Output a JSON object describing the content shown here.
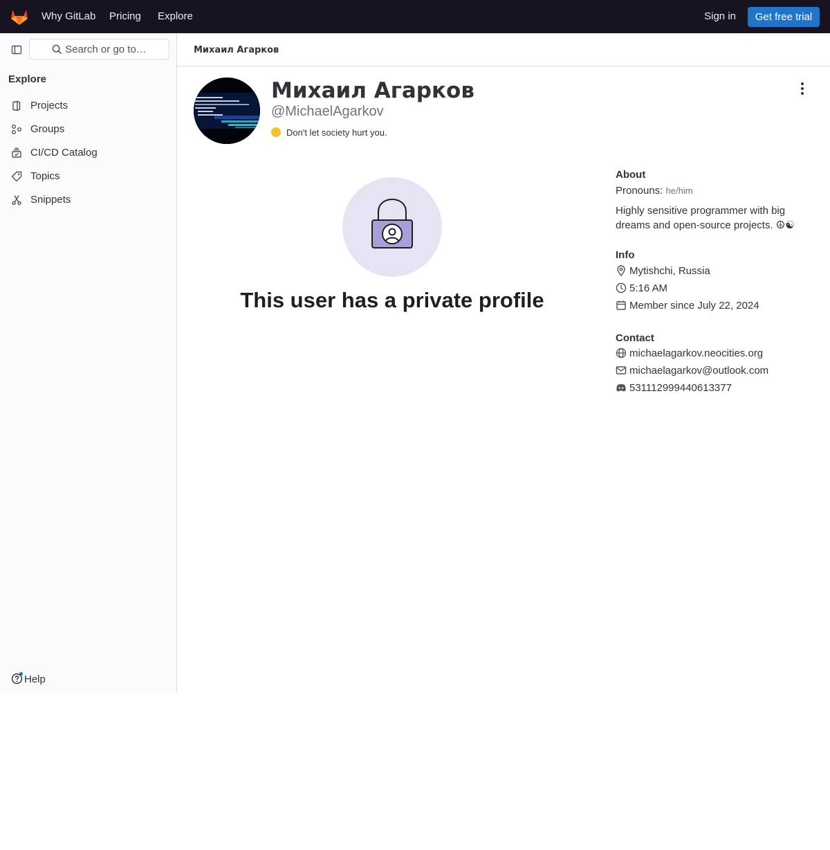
{
  "topbar": {
    "nav": [
      "Why GitLab",
      "Pricing",
      "Explore"
    ],
    "sign_in": "Sign in",
    "trial_button": "Get free trial"
  },
  "sidebar": {
    "search_placeholder": "Search or go to…",
    "section_title": "Explore",
    "items": [
      {
        "label": "Projects",
        "icon": "project-icon"
      },
      {
        "label": "Groups",
        "icon": "group-icon"
      },
      {
        "label": "CI/CD Catalog",
        "icon": "catalog-icon"
      },
      {
        "label": "Topics",
        "icon": "label-icon"
      },
      {
        "label": "Snippets",
        "icon": "snippet-icon"
      }
    ],
    "help_label": "Help"
  },
  "breadcrumb": "Михаил Агарков",
  "profile": {
    "name": "Михаил Агарков",
    "username": "@MichaelAgarkov",
    "status_text": "Don't let society hurt you.",
    "private_message": "This user has a private profile"
  },
  "about": {
    "heading": "About",
    "pronouns_label": "Pronouns:",
    "pronouns_value": "he/him",
    "bio": "Highly sensitive programmer with big dreams and open-source projects. ☮☯"
  },
  "info": {
    "heading": "Info",
    "location": "Mytishchi, Russia",
    "local_time": "5:16 AM",
    "member_since": "Member since July 22, 2024"
  },
  "contact": {
    "heading": "Contact",
    "website": "michaelagarkov.neocities.org",
    "email": "michaelagarkov@outlook.com",
    "discord": "531112999440613377"
  },
  "colors": {
    "topbar_bg": "#171321",
    "primary_button": "#1f75cb",
    "lock_circle": "#e6e4f2",
    "lock_body": "#a89fd7"
  }
}
